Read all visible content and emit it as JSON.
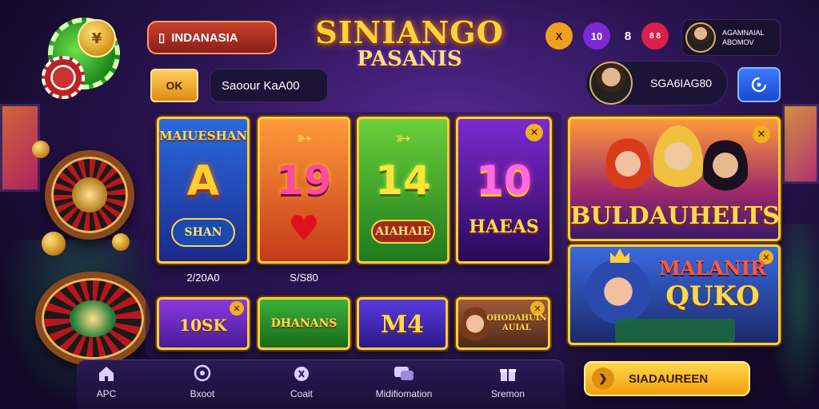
{
  "header": {
    "language_label": "INDANASIA",
    "logo_line1": "SINIANGO",
    "logo_line2": "PASANIS",
    "icon_x_label": "X",
    "icon_10_label": "10",
    "icon_8_label": "8",
    "icon_red_label": "8 8",
    "profile_top_text": "AGAMNAIAL ABOMOV"
  },
  "toolbar": {
    "ok_label": "OK",
    "search_value": "Saoour KaA00",
    "balance_label": "SGA6IAG80"
  },
  "games": [
    {
      "title": "MAIUESHAN",
      "symbol": "A",
      "plate": "SHAN",
      "price": "2/20A0"
    },
    {
      "title": "",
      "symbol": "19",
      "plate": "",
      "price": "S/S80"
    },
    {
      "title": "",
      "symbol": "14",
      "plate": "AIAHAIE",
      "price": ""
    },
    {
      "title": "",
      "symbol": "10",
      "plate": "HAEAS",
      "price": ""
    }
  ],
  "small_games": [
    {
      "label": "10SK"
    },
    {
      "label": "DHANANS"
    },
    {
      "label": "M4"
    },
    {
      "label": "OHODAHUIN AUIAL"
    }
  ],
  "featured": [
    {
      "title": "BULDAUHELTS"
    },
    {
      "title_line1": "MALANIR",
      "title_line2": "QUKO"
    }
  ],
  "bottom_nav": {
    "items": [
      {
        "label": "APC",
        "icon": "home-icon"
      },
      {
        "label": "Bxoot",
        "icon": "chat-icon"
      },
      {
        "label": "Coait",
        "icon": "coin-icon"
      },
      {
        "label": "Midifiomation",
        "icon": "message-icon"
      },
      {
        "label": "Sremon",
        "icon": "gift-icon"
      }
    ],
    "signup_label": "SIADAUREEN"
  },
  "colors": {
    "background": "#2a1450",
    "accent_gold": "#ffcf3a",
    "brand_red": "#c8402a",
    "action_blue": "#3a7aff"
  }
}
